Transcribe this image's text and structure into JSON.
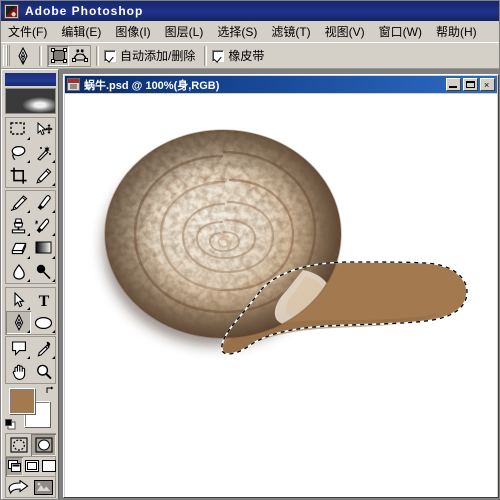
{
  "app": {
    "title": "Adobe Photoshop",
    "icon": "photoshop-app-icon"
  },
  "menubar": {
    "items": [
      {
        "label": "文件(F)",
        "name": "menu-file"
      },
      {
        "label": "编辑(E)",
        "name": "menu-edit"
      },
      {
        "label": "图像(I)",
        "name": "menu-image"
      },
      {
        "label": "图层(L)",
        "name": "menu-layer"
      },
      {
        "label": "选择(S)",
        "name": "menu-select"
      },
      {
        "label": "滤镜(T)",
        "name": "menu-filter"
      },
      {
        "label": "视图(V)",
        "name": "menu-view"
      },
      {
        "label": "窗口(W)",
        "name": "menu-window"
      },
      {
        "label": "帮助(H)",
        "name": "menu-help"
      }
    ]
  },
  "options_bar": {
    "active_tool_icon": "pen-tool-icon",
    "buttons": [
      {
        "name": "shape-layers-button",
        "icon": "shape-layer-icon",
        "pressed": true
      },
      {
        "name": "paths-button",
        "icon": "path-icon",
        "pressed": false
      }
    ],
    "checkboxes": [
      {
        "label": "自动添加/删除",
        "checked": true,
        "name": "auto-add-delete-checkbox"
      },
      {
        "label": "橡皮带",
        "checked": true,
        "name": "rubber-band-checkbox"
      }
    ]
  },
  "toolbox": {
    "foreground_color": "#a37a50",
    "background_color": "#ffffff",
    "tools": [
      {
        "name": "marquee-tool",
        "icon": "rectangular-marquee-icon",
        "has_submenu": true,
        "active": false
      },
      {
        "name": "move-tool",
        "icon": "move-icon",
        "has_submenu": false,
        "active": false
      },
      {
        "name": "lasso-tool",
        "icon": "lasso-icon",
        "has_submenu": true,
        "active": false
      },
      {
        "name": "magic-wand-tool",
        "icon": "magic-wand-icon",
        "has_submenu": false,
        "active": false
      },
      {
        "name": "crop-tool",
        "icon": "crop-icon",
        "has_submenu": false,
        "active": false
      },
      {
        "name": "slice-tool",
        "icon": "slice-icon",
        "has_submenu": true,
        "active": false
      },
      {
        "name": "healing-brush-tool",
        "icon": "healing-brush-icon",
        "has_submenu": true,
        "active": false
      },
      {
        "name": "brush-tool",
        "icon": "paintbrush-icon",
        "has_submenu": true,
        "active": false
      },
      {
        "name": "clone-stamp-tool",
        "icon": "clone-stamp-icon",
        "has_submenu": true,
        "active": false
      },
      {
        "name": "history-brush-tool",
        "icon": "history-brush-icon",
        "has_submenu": true,
        "active": false
      },
      {
        "name": "eraser-tool",
        "icon": "eraser-icon",
        "has_submenu": true,
        "active": false
      },
      {
        "name": "gradient-tool",
        "icon": "gradient-icon",
        "has_submenu": true,
        "active": false
      },
      {
        "name": "blur-tool",
        "icon": "blur-drop-icon",
        "has_submenu": true,
        "active": false
      },
      {
        "name": "dodge-tool",
        "icon": "dodge-burn-icon",
        "has_submenu": true,
        "active": false
      },
      {
        "name": "path-selection-tool",
        "icon": "path-selection-arrow-icon",
        "has_submenu": true,
        "active": false
      },
      {
        "name": "type-tool",
        "icon": "type-t-icon",
        "has_submenu": false,
        "active": false
      },
      {
        "name": "pen-tool",
        "icon": "pen-nib-icon",
        "has_submenu": true,
        "active": true
      },
      {
        "name": "shape-tool",
        "icon": "ellipse-shape-icon",
        "has_submenu": true,
        "active": false
      },
      {
        "name": "notes-tool",
        "icon": "notes-icon",
        "has_submenu": true,
        "active": false
      },
      {
        "name": "eyedropper-tool",
        "icon": "eyedropper-icon",
        "has_submenu": true,
        "active": false
      },
      {
        "name": "hand-tool",
        "icon": "hand-icon",
        "has_submenu": false,
        "active": false
      },
      {
        "name": "zoom-tool",
        "icon": "magnifier-icon",
        "has_submenu": false,
        "active": false
      }
    ],
    "mask_modes": [
      {
        "name": "standard-mode-button",
        "icon": "standard-mask-icon",
        "active": false
      },
      {
        "name": "quick-mask-mode-button",
        "icon": "quick-mask-icon",
        "active": true
      }
    ],
    "screen_modes": [
      {
        "name": "standard-screen-mode-button",
        "icon": "standard-screen-icon",
        "active": true
      },
      {
        "name": "full-screen-menubar-mode-button",
        "icon": "full-screen-menubar-icon",
        "active": false
      },
      {
        "name": "full-screen-mode-button",
        "icon": "full-screen-icon",
        "active": false
      }
    ],
    "jump_buttons": [
      {
        "name": "jump-to-imageready-button",
        "icon": "jump-to-icon"
      },
      {
        "name": "imageready-button",
        "icon": "imageready-icon"
      }
    ]
  },
  "document": {
    "title": "蜗牛.psd @ 100%(身,RGB)",
    "zoom": "100%",
    "layer_name": "身",
    "color_mode": "RGB",
    "window_buttons": [
      {
        "name": "doc-minimize-button",
        "icon": "minimize-icon"
      },
      {
        "name": "doc-maximize-button",
        "icon": "maximize-icon"
      },
      {
        "name": "doc-close-button",
        "icon": "close-icon",
        "label": "×"
      }
    ],
    "artwork": {
      "description": "snail-illustration",
      "shell_colors": [
        "#efe7db",
        "#c6ab8c",
        "#8a6443",
        "#5b3e28"
      ],
      "body_color": "#a37a50",
      "selection": "marching-ants-dashed-outline",
      "canvas_background": "#ffffff"
    }
  }
}
